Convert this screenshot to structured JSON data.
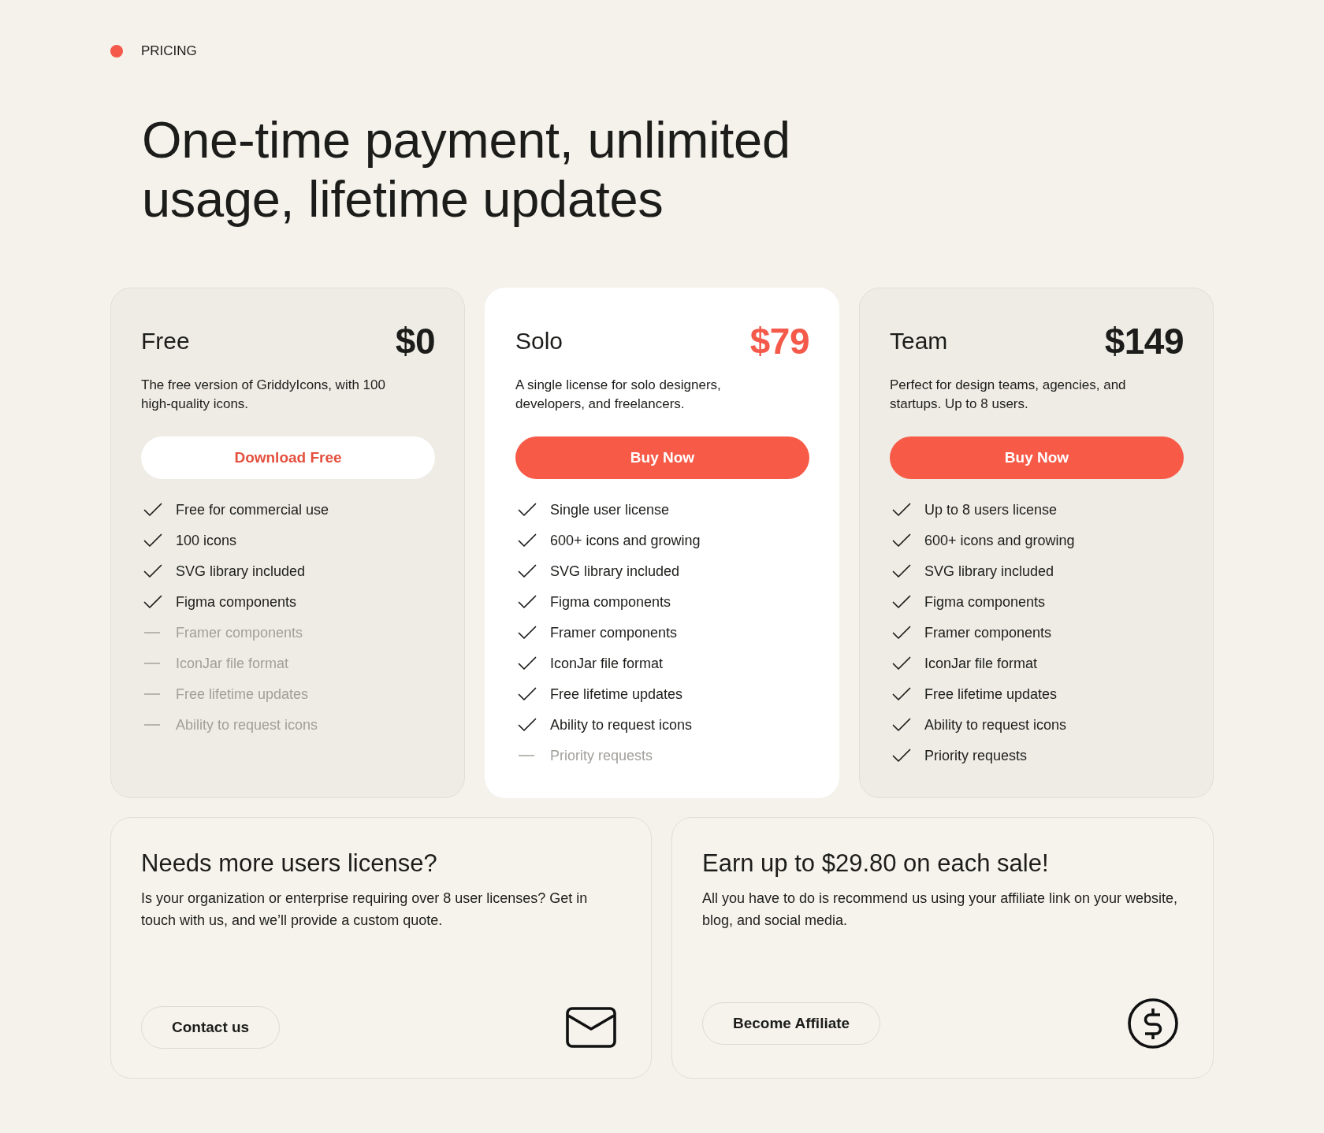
{
  "eyebrow": {
    "label": "PRICING"
  },
  "headline": "One-time payment, unlimited usage, lifetime updates",
  "plans": [
    {
      "name": "Free",
      "price": "$0",
      "featured": false,
      "description": "The free version of GriddyIcons, with 100 high-quality icons.",
      "button": {
        "label": "Download Free",
        "kind": "light"
      },
      "features": [
        {
          "text": "Free for commercial use",
          "included": true
        },
        {
          "text": "100 icons",
          "included": true
        },
        {
          "text": "SVG library included",
          "included": true
        },
        {
          "text": "Figma components",
          "included": true
        },
        {
          "text": "Framer components",
          "included": false
        },
        {
          "text": "IconJar file format",
          "included": false
        },
        {
          "text": "Free lifetime updates",
          "included": false
        },
        {
          "text": "Ability to request icons",
          "included": false
        }
      ]
    },
    {
      "name": "Solo",
      "price": "$79",
      "featured": true,
      "description": "A single license for solo designers, developers, and freelancers.",
      "button": {
        "label": "Buy Now",
        "kind": "primary"
      },
      "features": [
        {
          "text": "Single user license",
          "included": true
        },
        {
          "text": "600+ icons and growing",
          "included": true
        },
        {
          "text": "SVG library included",
          "included": true
        },
        {
          "text": "Figma components",
          "included": true
        },
        {
          "text": "Framer components",
          "included": true
        },
        {
          "text": "IconJar file format",
          "included": true
        },
        {
          "text": "Free lifetime updates",
          "included": true
        },
        {
          "text": "Ability to request icons",
          "included": true
        },
        {
          "text": "Priority requests",
          "included": false
        }
      ]
    },
    {
      "name": "Team",
      "price": "$149",
      "featured": false,
      "description": "Perfect for design teams, agencies, and startups. Up to 8 users.",
      "button": {
        "label": "Buy Now",
        "kind": "primary"
      },
      "features": [
        {
          "text": "Up to 8 users license",
          "included": true
        },
        {
          "text": "600+ icons and growing",
          "included": true
        },
        {
          "text": "SVG library included",
          "included": true
        },
        {
          "text": "Figma components",
          "included": true
        },
        {
          "text": "Framer components",
          "included": true
        },
        {
          "text": "IconJar file format",
          "included": true
        },
        {
          "text": "Free lifetime updates",
          "included": true
        },
        {
          "text": "Ability to request icons",
          "included": true
        },
        {
          "text": "Priority requests",
          "included": true
        }
      ]
    }
  ],
  "extras": [
    {
      "kind": "contact",
      "title": "Needs more users license?",
      "body": "Is your organization or enterprise requiring over 8 user licenses? Get in touch with us, and we’ll provide a custom quote.",
      "button": "Contact us"
    },
    {
      "kind": "affiliate",
      "title": "Earn up to $29.80 on each sale!",
      "body": "All you have to do is recommend us using your affiliate link on your website, blog, and social media.",
      "button": "Become Affiliate"
    }
  ]
}
